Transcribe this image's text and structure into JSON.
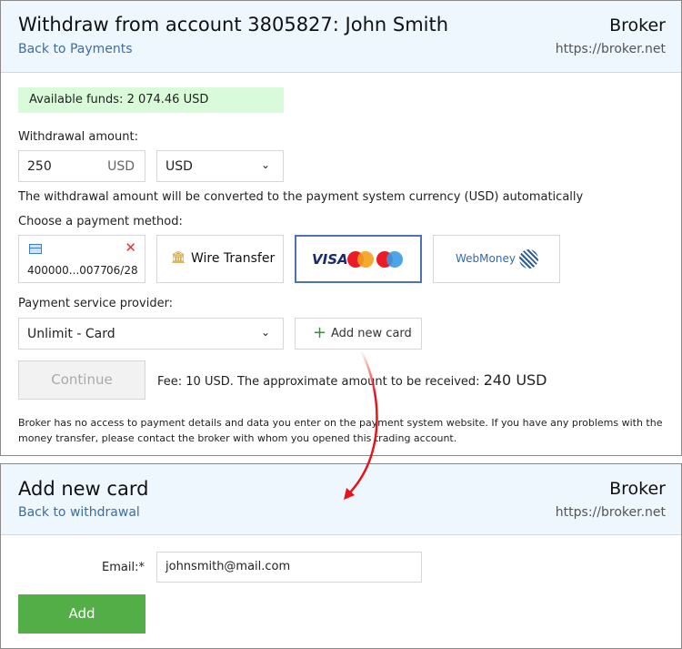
{
  "withdraw": {
    "title": "Withdraw from account 3805827: John Smith",
    "back": "Back to Payments",
    "brand": "Broker",
    "url": "https://broker.net",
    "available": "Available funds: 2 074.46 USD",
    "amount_label": "Withdrawal amount:",
    "amount_value": "250",
    "amount_currency": "USD",
    "currency_select": "USD",
    "conversion_note": "The withdrawal amount will be converted to the payment system currency (USD) automatically",
    "method_label": "Choose a payment method:",
    "methods": {
      "card_number": "400000...0077",
      "card_expiry": "06/28",
      "wire": "Wire Transfer",
      "visa": "VISA",
      "webmoney": "WebMoney"
    },
    "selected_method": "visa",
    "provider_label": "Payment service provider:",
    "provider_value": "Unlimit - Card",
    "add_card": "Add new card",
    "continue": "Continue",
    "fee": "Fee: 10 USD. The approximate amount to be received:",
    "received": "240 USD",
    "disclaimer": "Broker has no access to payment details and data you enter on the payment system website. If you have any problems with the money transfer, please contact the broker with whom you opened this trading account."
  },
  "add_card": {
    "title": "Add new card",
    "back": "Back to withdrawal",
    "brand": "Broker",
    "url": "https://broker.net",
    "email_label": "Email:*",
    "email_value": "johnsmith@mail.com",
    "add": "Add"
  },
  "colors": {
    "accent": "#4d72b5",
    "green": "#53ae47",
    "arrow": "#e8141b",
    "funds_bg": "#d9fbd9"
  }
}
